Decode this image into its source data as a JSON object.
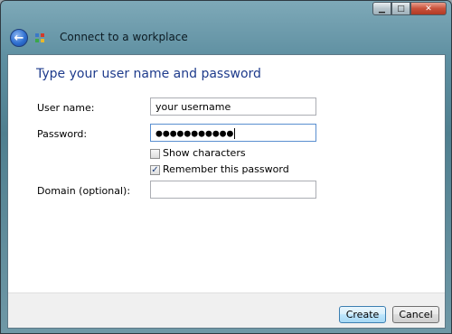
{
  "window": {
    "title": "Connect to a workplace",
    "controls": {
      "minimize": "▁",
      "maximize": "□",
      "close": "✕"
    },
    "back_icon": "back-arrow-icon",
    "app_icon": "network-icon"
  },
  "page": {
    "heading": "Type your user name and password",
    "username": {
      "label": "User name:",
      "value": "your username"
    },
    "password": {
      "label": "Password:",
      "value": "●●●●●●●●●●●"
    },
    "show_characters": {
      "label": "Show characters",
      "checked": false
    },
    "remember_password": {
      "label": "Remember this password",
      "checked": true,
      "mark": "✓"
    },
    "domain": {
      "label": "Domain (optional):",
      "value": ""
    }
  },
  "footer": {
    "create_label": "Create",
    "cancel_label": "Cancel"
  },
  "colors": {
    "heading": "#1e3b8c",
    "accent": "#3c7fb1"
  }
}
